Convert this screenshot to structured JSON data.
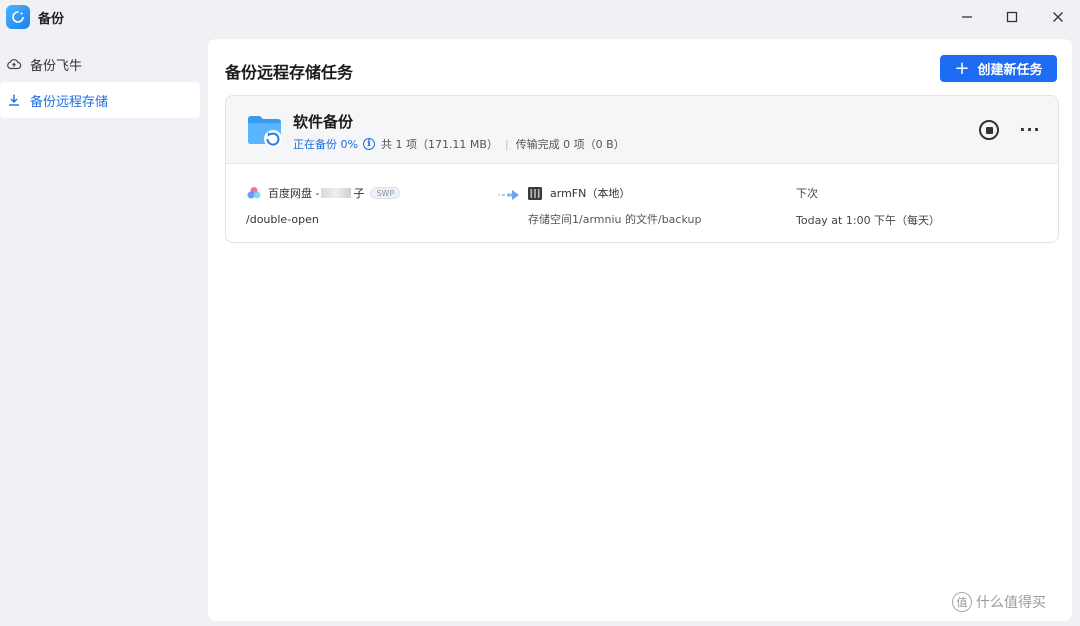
{
  "window": {
    "title": "备份",
    "icons": {
      "app": "backup-app-icon",
      "minimize": "minimize-icon",
      "maximize": "maximize-icon",
      "close": "close-icon"
    }
  },
  "sidebar": {
    "items": [
      {
        "label": "备份飞牛",
        "icon": "cloud-upload-icon",
        "active": false
      },
      {
        "label": "备份远程存储",
        "icon": "download-icon",
        "active": true
      }
    ]
  },
  "main": {
    "title": "备份远程存储任务",
    "create_button": "创建新任务"
  },
  "task": {
    "name": "软件备份",
    "status": "正在备份 0%",
    "total": "共 1 项（171.11 MB）",
    "transferred": "传输完成 0 项（0 B）",
    "source": {
      "name_prefix": "百度网盘 - ",
      "name_suffix": "子",
      "badge": "SWP",
      "path": "/double-open"
    },
    "destination": {
      "name": "armFN（本地）",
      "path": "存储空间1/armniu 的文件/backup"
    },
    "schedule": {
      "label": "下次",
      "time": "Today at 1:00 下午（每天）"
    }
  },
  "watermark": {
    "logo": "值",
    "text": "什么值得买"
  },
  "colors": {
    "accent": "#1d6cf2",
    "link": "#1d6fe0",
    "background": "#f0f1f4"
  }
}
